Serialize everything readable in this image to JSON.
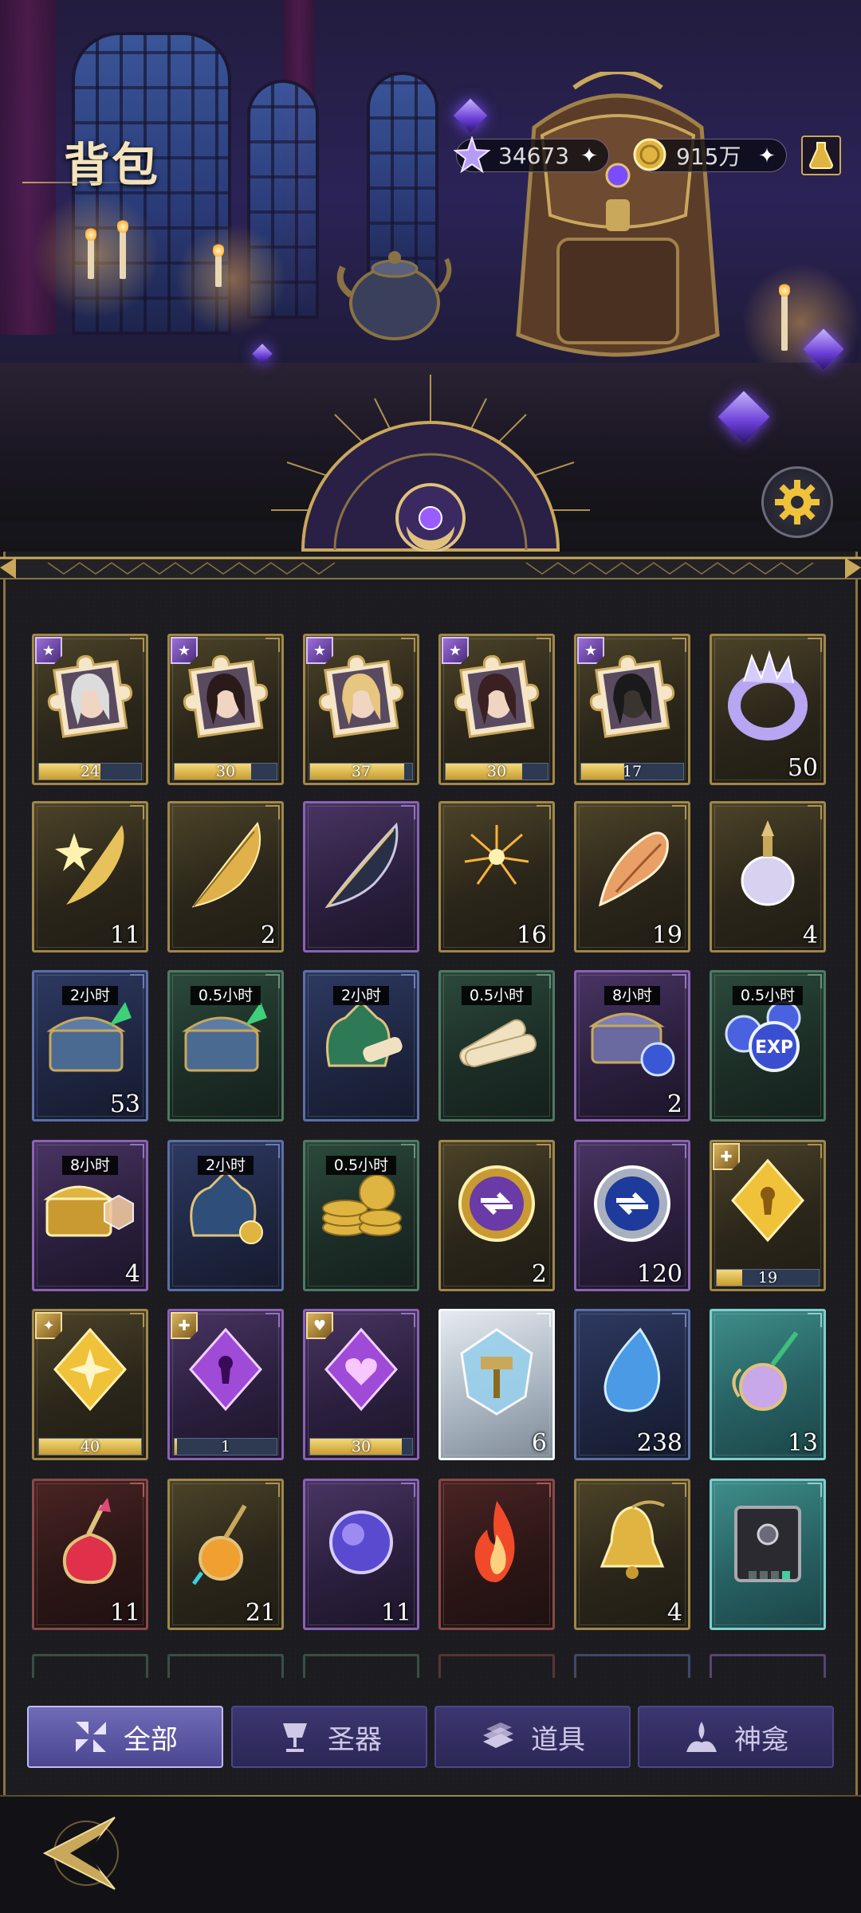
{
  "header": {
    "title": "背包",
    "currencies": [
      {
        "icon": "star-crystal-icon",
        "value": "34673"
      },
      {
        "icon": "gold-coin-icon",
        "value": "915万"
      }
    ]
  },
  "items": [
    {
      "icon": "puzzle-portrait-white-hair-icon",
      "rarity": "gold",
      "badge": "★",
      "bar_text": "24",
      "bar_fill": 0.6,
      "qty": null,
      "time": null
    },
    {
      "icon": "puzzle-portrait-dark-hair-icon",
      "rarity": "gold",
      "badge": "★",
      "bar_text": "30",
      "bar_fill": 0.75,
      "qty": null,
      "time": null
    },
    {
      "icon": "puzzle-portrait-blonde-icon",
      "rarity": "gold",
      "badge": "★",
      "bar_text": "37",
      "bar_fill": 0.92,
      "qty": null,
      "time": null
    },
    {
      "icon": "puzzle-portrait-veiled-icon",
      "rarity": "gold",
      "badge": "★",
      "bar_text": "30",
      "bar_fill": 0.75,
      "qty": null,
      "time": null
    },
    {
      "icon": "puzzle-portrait-golden-mask-icon",
      "rarity": "gold",
      "badge": "★",
      "bar_text": "17",
      "bar_fill": 0.42,
      "qty": null,
      "time": null
    },
    {
      "icon": "crystal-ring-icon",
      "rarity": "gold",
      "badge": null,
      "bar_text": null,
      "qty": "50",
      "time": null
    },
    {
      "icon": "golden-star-feather-icon",
      "rarity": "gold",
      "badge": null,
      "bar_text": null,
      "qty": "11",
      "time": null
    },
    {
      "icon": "golden-feather-icon",
      "rarity": "gold",
      "badge": null,
      "bar_text": null,
      "qty": "2",
      "time": null
    },
    {
      "icon": "dark-feather-icon",
      "rarity": "purple",
      "badge": null,
      "bar_text": null,
      "qty": "",
      "time": null
    },
    {
      "icon": "fireworks-icon",
      "rarity": "gold",
      "badge": null,
      "bar_text": null,
      "qty": "16",
      "time": null
    },
    {
      "icon": "conch-shell-icon",
      "rarity": "gold",
      "badge": null,
      "bar_text": null,
      "qty": "19",
      "time": null
    },
    {
      "icon": "perfume-bottle-icon",
      "rarity": "gold",
      "badge": null,
      "bar_text": null,
      "qty": "4",
      "time": null
    },
    {
      "icon": "blue-chest-green-arrow-icon",
      "rarity": "blue",
      "badge": null,
      "bar_text": null,
      "qty": "53",
      "time": "2小时"
    },
    {
      "icon": "blue-chest-green-arrow-icon",
      "rarity": "green",
      "badge": null,
      "bar_text": null,
      "qty": "",
      "time": "0.5小时"
    },
    {
      "icon": "green-sack-scroll-icon",
      "rarity": "blue",
      "badge": null,
      "bar_text": null,
      "qty": "",
      "time": "2小时"
    },
    {
      "icon": "scroll-bundle-icon",
      "rarity": "green",
      "badge": null,
      "bar_text": null,
      "qty": "",
      "time": "0.5小时"
    },
    {
      "icon": "exp-chest-icon",
      "rarity": "purple",
      "badge": null,
      "bar_text": null,
      "qty": "2",
      "time": "8小时"
    },
    {
      "icon": "exp-orbs-icon",
      "rarity": "green",
      "badge": null,
      "bar_text": null,
      "qty": "",
      "time": "0.5小时"
    },
    {
      "icon": "gold-chest-hexagon-icon",
      "rarity": "purple",
      "badge": null,
      "bar_text": null,
      "qty": "4",
      "time": "8小时"
    },
    {
      "icon": "blue-coin-sack-icon",
      "rarity": "blue",
      "badge": null,
      "bar_text": null,
      "qty": "",
      "time": "2小时"
    },
    {
      "icon": "gold-coin-stack-icon",
      "rarity": "green",
      "badge": null,
      "bar_text": null,
      "qty": "",
      "time": "0.5小时"
    },
    {
      "icon": "purple-medal-icon",
      "rarity": "gold",
      "badge": null,
      "bar_text": null,
      "qty": "2",
      "time": null
    },
    {
      "icon": "blue-medal-icon",
      "rarity": "purple",
      "badge": null,
      "bar_text": null,
      "qty": "120",
      "time": null
    },
    {
      "icon": "gold-keyhole-gem-icon",
      "rarity": "gold",
      "badge": "✚",
      "bar_text": "19",
      "bar_fill": 0.25,
      "qty": null,
      "time": null
    },
    {
      "icon": "gold-diamond-gem-icon",
      "rarity": "gold",
      "badge": "✦",
      "bar_text": "40",
      "bar_fill": 1,
      "qty": null,
      "time": null
    },
    {
      "icon": "purple-keyhole-gem-icon",
      "rarity": "purple",
      "badge": "✚",
      "bar_text": "1",
      "bar_fill": 0.02,
      "qty": null,
      "time": null
    },
    {
      "icon": "purple-heart-gem-icon",
      "rarity": "purple",
      "badge": "♥",
      "bar_text": "30",
      "bar_fill": 0.9,
      "qty": null,
      "time": null
    },
    {
      "icon": "crystal-hammer-icon",
      "rarity": "silver",
      "badge": null,
      "bar_text": null,
      "qty": "6",
      "time": null
    },
    {
      "icon": "blue-droplet-crystal-icon",
      "rarity": "blue",
      "badge": null,
      "bar_text": null,
      "qty": "238",
      "time": null
    },
    {
      "icon": "ornate-potion-icon",
      "rarity": "teal",
      "badge": null,
      "bar_text": null,
      "qty": "13",
      "time": null
    },
    {
      "icon": "red-potion-icon",
      "rarity": "red",
      "badge": null,
      "bar_text": null,
      "qty": "11",
      "time": null
    },
    {
      "icon": "orange-potion-icon",
      "rarity": "gold",
      "badge": null,
      "bar_text": null,
      "qty": "21",
      "time": null
    },
    {
      "icon": "purple-orb-icon",
      "rarity": "purple",
      "badge": null,
      "bar_text": null,
      "qty": "11",
      "time": null
    },
    {
      "icon": "fire-essence-icon",
      "rarity": "red",
      "badge": null,
      "bar_text": null,
      "qty": "",
      "time": null
    },
    {
      "icon": "golden-bell-icon",
      "rarity": "gold",
      "badge": null,
      "bar_text": null,
      "qty": "4",
      "time": null
    },
    {
      "icon": "ornate-book-icon",
      "rarity": "teal",
      "badge": null,
      "bar_text": null,
      "qty": "",
      "time": null
    }
  ],
  "tabs": [
    {
      "label": "全部",
      "icon": "all-grid-icon",
      "active": true
    },
    {
      "label": "圣器",
      "icon": "relic-chalice-icon",
      "active": false
    },
    {
      "label": "道具",
      "icon": "items-stack-icon",
      "active": false
    },
    {
      "label": "神龛",
      "icon": "shrine-icon",
      "active": false
    }
  ],
  "colors": {
    "accent_gold": "#c9a85c",
    "tab_active": "#6f6bb7",
    "tab_idle": "#3c3670"
  }
}
